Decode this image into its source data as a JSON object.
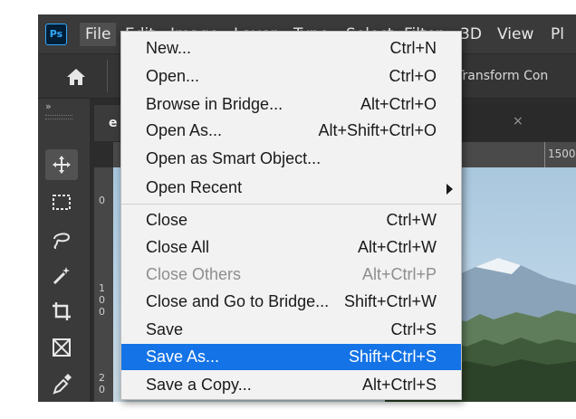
{
  "app": {
    "logo": "Ps"
  },
  "menubar": {
    "items": [
      {
        "label": "File",
        "active": true
      },
      {
        "label": "Edit"
      },
      {
        "label": "Image"
      },
      {
        "label": "Layer"
      },
      {
        "label": "Type"
      },
      {
        "label": "Select"
      },
      {
        "label": "Filter"
      },
      {
        "label": "3D"
      },
      {
        "label": "View"
      },
      {
        "label": "Pl"
      }
    ]
  },
  "options_bar": {
    "home_icon": "home-icon",
    "transform_text": "Transform Con"
  },
  "toolbar": {
    "collapse": "»",
    "tools": [
      "move-tool-icon",
      "marquee-tool-icon",
      "lasso-tool-icon",
      "magic-wand-tool-icon",
      "crop-tool-icon",
      "frame-tool-icon",
      "eyedropper-tool-icon"
    ]
  },
  "document": {
    "tab_label": "e",
    "tab_close": "×",
    "ruler_h": "1500",
    "ruler_v_top": "0",
    "ruler_v_mid": [
      "1",
      "0",
      "0"
    ],
    "ruler_v_bot": [
      "2",
      "0"
    ]
  },
  "file_menu": {
    "items": [
      {
        "label": "New...",
        "shortcut": "Ctrl+N"
      },
      {
        "label": "Open...",
        "shortcut": "Ctrl+O"
      },
      {
        "label": "Browse in Bridge...",
        "shortcut": "Alt+Ctrl+O"
      },
      {
        "label": "Open As...",
        "shortcut": "Alt+Shift+Ctrl+O"
      },
      {
        "label": "Open as Smart Object...",
        "shortcut": ""
      },
      {
        "label": "Open Recent",
        "shortcut": "",
        "submenu": true
      },
      {
        "label": "Close",
        "shortcut": "Ctrl+W"
      },
      {
        "label": "Close All",
        "shortcut": "Alt+Ctrl+W"
      },
      {
        "label": "Close Others",
        "shortcut": "Alt+Ctrl+P",
        "disabled": true
      },
      {
        "label": "Close and Go to Bridge...",
        "shortcut": "Shift+Ctrl+W"
      },
      {
        "label": "Save",
        "shortcut": "Ctrl+S"
      },
      {
        "label": "Save As...",
        "shortcut": "Shift+Ctrl+S",
        "highlighted": true
      },
      {
        "label": "Save a Copy...",
        "shortcut": "Alt+Ctrl+S"
      }
    ]
  },
  "colors": {
    "highlight": "#1473e6",
    "menu_bg": "#f2f2f2",
    "app_bg": "#2c2c2c",
    "ps_blue": "#31a8ff"
  }
}
